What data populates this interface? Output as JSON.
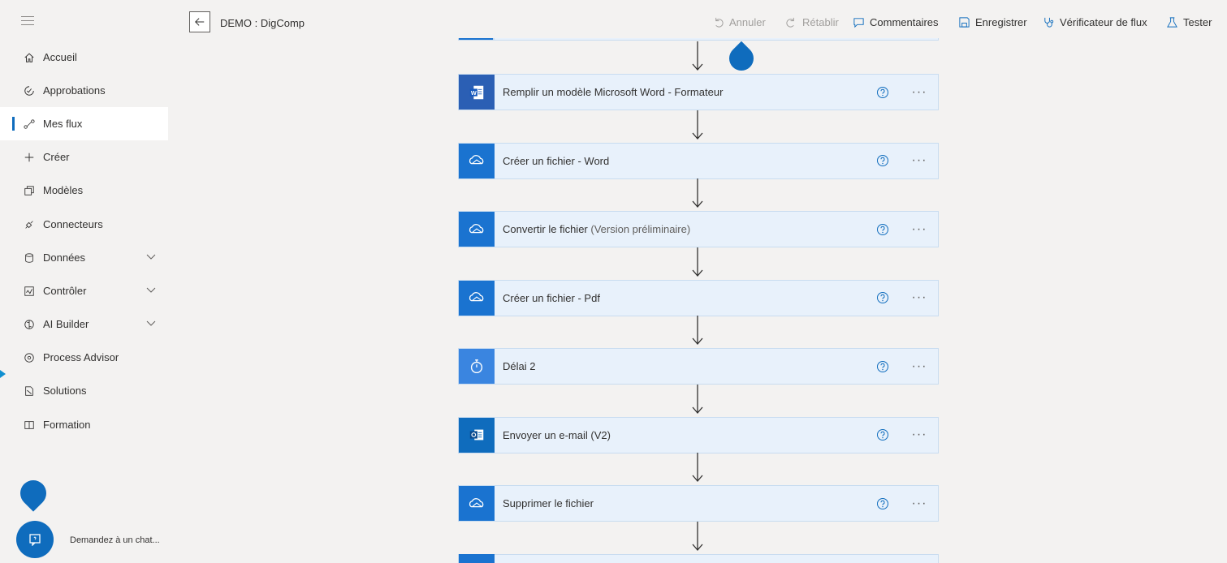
{
  "header": {
    "flow_title": "DEMO : DigComp",
    "undo_label": "Annuler",
    "redo_label": "Rétablir",
    "comments_label": "Commentaires",
    "save_label": "Enregistrer",
    "checker_label": "Vérificateur de flux",
    "test_label": "Tester"
  },
  "sidebar": {
    "items": [
      {
        "label": "Accueil",
        "icon": "home-icon"
      },
      {
        "label": "Approbations",
        "icon": "approvals-icon"
      },
      {
        "label": "Mes flux",
        "icon": "flows-icon",
        "active": true
      },
      {
        "label": "Créer",
        "icon": "plus-icon"
      },
      {
        "label": "Modèles",
        "icon": "templates-icon"
      },
      {
        "label": "Connecteurs",
        "icon": "connectors-icon"
      },
      {
        "label": "Données",
        "icon": "data-icon",
        "expandable": true
      },
      {
        "label": "Contrôler",
        "icon": "monitor-icon",
        "expandable": true
      },
      {
        "label": "AI Builder",
        "icon": "ai-builder-icon",
        "expandable": true
      },
      {
        "label": "Process Advisor",
        "icon": "process-advisor-icon"
      },
      {
        "label": "Solutions",
        "icon": "solutions-icon"
      },
      {
        "label": "Formation",
        "icon": "learn-icon"
      }
    ],
    "chat_label": "Demandez à un chat..."
  },
  "steps": [
    {
      "label": "Remplir un modèle Microsoft Word - Formateur",
      "sub": "",
      "icon": "word-icon"
    },
    {
      "label": "Créer un fichier - Word",
      "sub": "",
      "icon": "onedrive-icon"
    },
    {
      "label": "Convertir le fichier",
      "sub": "(Version préliminaire)",
      "icon": "onedrive-icon"
    },
    {
      "label": "Créer un fichier - Pdf",
      "sub": "",
      "icon": "onedrive-icon"
    },
    {
      "label": "Délai 2",
      "sub": "",
      "icon": "timer-icon"
    },
    {
      "label": "Envoyer un e-mail (V2)",
      "sub": "",
      "icon": "outlook-icon"
    },
    {
      "label": "Supprimer le fichier",
      "sub": "",
      "icon": "onedrive-icon"
    }
  ],
  "more_label": "···",
  "colors": {
    "accent": "#0f6cbd",
    "step_bg": "#e8f1fb",
    "canvas_bg": "#f3f2f1"
  }
}
